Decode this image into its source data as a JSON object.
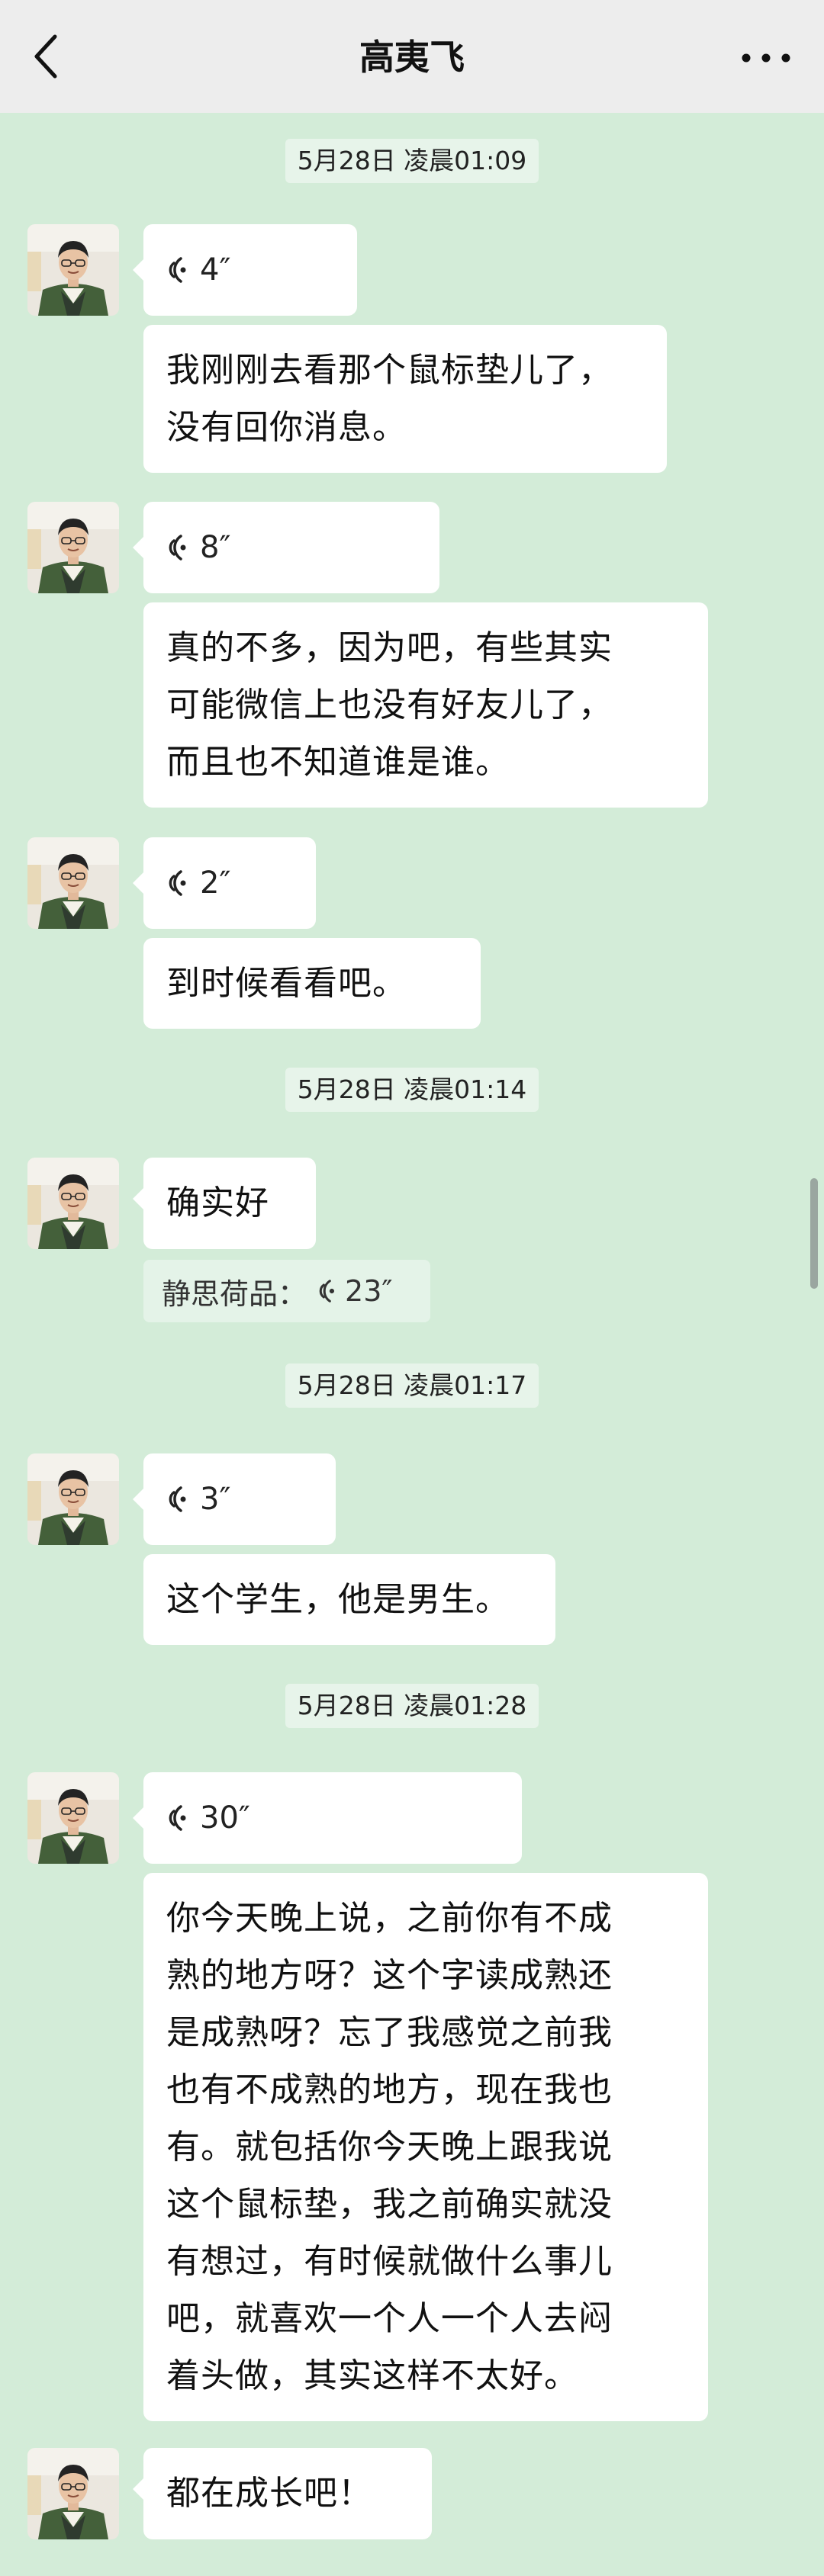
{
  "header": {
    "back_icon": "chevron-left-icon",
    "title": "高夷飞",
    "more_icon": "more-dots-icon"
  },
  "messages": {
    "ts1": "5月28日 凌晨01:09",
    "v1": "4″",
    "t1": [
      "我刚刚去看那个鼠标垫儿了，",
      "没有回你消息。"
    ],
    "v2": "8″",
    "t2": [
      "真的不多，因为吧，有些其实",
      "可能微信上也没有好友儿了，",
      "而且也不知道谁是谁。"
    ],
    "v3": "2″",
    "t3": "到时候看看吧。",
    "ts2": "5月28日 凌晨01:14",
    "t4": "确实好",
    "quote_name": "静思荷品：",
    "quote_duration": "23″",
    "ts3": "5月28日 凌晨01:17",
    "v4": "3″",
    "t5": "这个学生，他是男生。",
    "ts4": "5月28日 凌晨01:28",
    "v5": "30″",
    "t6": [
      "你今天晚上说，之前你有不成",
      "熟的地方呀？这个字读成熟还",
      "是成熟呀？忘了我感觉之前我",
      "也有不成熟的地方，现在我也",
      "有。就包括你今天晚上跟我说",
      "这个鼠标垫，我之前确实就没",
      "有想过，有时候就做什么事儿",
      "吧，就喜欢一个人一个人去闷",
      "着头做，其实这样不太好。"
    ],
    "t7": "都在成长吧！"
  },
  "colors": {
    "background": "#d3ecd8",
    "header": "#ededed",
    "bubble": "#ffffff"
  }
}
